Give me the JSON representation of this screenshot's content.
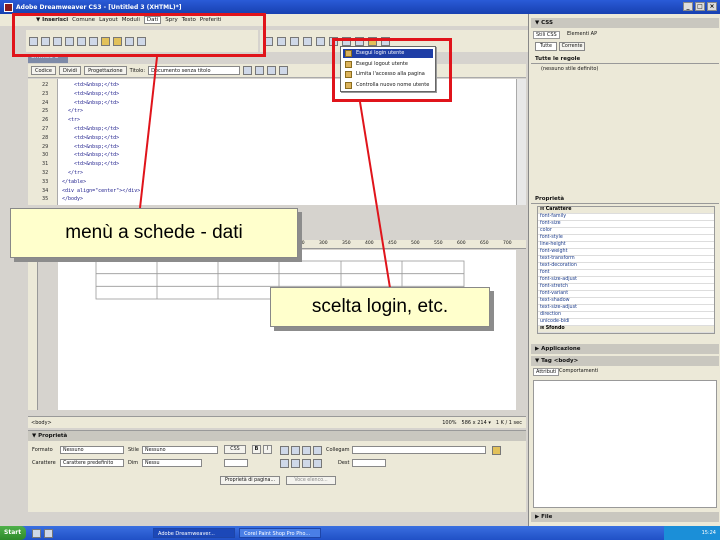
{
  "window": {
    "title": "Adobe Dreamweaver CS3 - [Untitled 3 (XHTML)*]",
    "controls": [
      "_",
      "□",
      "×"
    ]
  },
  "menubar": {
    "items": [
      "▼ Inserisci",
      "Comune",
      "Layout",
      "Moduli",
      "Dati",
      "Spry",
      "Testo",
      "Preferiti"
    ]
  },
  "document": {
    "tab": "Untitled-3",
    "views": {
      "code": "Codice",
      "split": "Dividi",
      "design": "Progettazione"
    },
    "title_label": "Titolo:",
    "title_value": "Documento senza titolo",
    "lines": [
      {
        "n": "22",
        "code": "    <td>&nbsp;</td>"
      },
      {
        "n": "23",
        "code": "    <td>&nbsp;</td>"
      },
      {
        "n": "24",
        "code": "    <td>&nbsp;</td>"
      },
      {
        "n": "25",
        "code": "  </tr>"
      },
      {
        "n": "26",
        "code": "  <tr>"
      },
      {
        "n": "27",
        "code": "    <td>&nbsp;</td>"
      },
      {
        "n": "28",
        "code": "    <td>&nbsp;</td>"
      },
      {
        "n": "29",
        "code": "    <td>&nbsp;</td>"
      },
      {
        "n": "30",
        "code": "    <td>&nbsp;</td>"
      },
      {
        "n": "31",
        "code": "    <td>&nbsp;</td>"
      },
      {
        "n": "32",
        "code": "  </tr>"
      },
      {
        "n": "33",
        "code": "</table>"
      },
      {
        "n": "34",
        "code": "<div align=\"center\"></div>"
      },
      {
        "n": "35",
        "code": "</body>"
      }
    ],
    "ruler_marks": [
      "250",
      "300",
      "350",
      "400",
      "450",
      "500",
      "550",
      "600",
      "650",
      "700"
    ]
  },
  "status": {
    "tag": "<body>",
    "zoom": "100%",
    "size": "586 x 214 ▾",
    "weight": "1 K / 1 sec"
  },
  "properties": {
    "title": "▼ Proprietà",
    "format_label": "Formato",
    "format_value": "Nessuno",
    "style_label": "Stile",
    "style_value": "Nessuno",
    "css_button": "CSS",
    "links_label": "Collegam",
    "font_label": "Carattere",
    "font_value": "Carattere predefinito",
    "size_label": "Dim",
    "size_value": "Nessu",
    "target_label": "Dest",
    "page_props_button": "Proprietà di pagina...",
    "list_item_button": "Voce elenco..."
  },
  "css_panel": {
    "title": "▼ CSS",
    "tab_css": "Stili CSS",
    "tab_ap": "Elementi AP",
    "btn_all": "Tutte",
    "btn_current": "Corrente",
    "rules_label": "Tutte le regole",
    "no_style": "(nessuno stile definito)",
    "props_label": "Proprietà",
    "group_font": "⊟ Carattere",
    "font_props": [
      "font-family",
      "font-size",
      "color",
      "font-style",
      "line-height",
      "font-weight",
      "text-transform",
      "text-decoration",
      "font",
      "font-size-adjust",
      "font-stretch",
      "font-variant",
      "text-shadow",
      "text-size-adjust",
      "direction",
      "unicode-bidi"
    ],
    "group_bg": "⊞ Sfondo"
  },
  "app_panel": {
    "title": "▶ Applicazione"
  },
  "tag_panel": {
    "title": "▼ Tag <body>",
    "tab_attr": "Attributi",
    "tab_behav": "Comportamenti"
  },
  "files_panel": {
    "title": "▶ File"
  },
  "login_menu": {
    "items": [
      {
        "label": "Esegui login utente",
        "selected": true
      },
      {
        "label": "Esegui logout utente",
        "selected": false
      },
      {
        "label": "Limita l'accesso alla pagina",
        "selected": false
      },
      {
        "label": "Controlla nuovo nome utente",
        "selected": false
      }
    ]
  },
  "callouts": {
    "tabs": "menù a schede - dati",
    "login": "scelta login, etc."
  },
  "taskbar": {
    "start": "Start",
    "tasks": [
      "Adobe Dreamweaver...",
      "Corel Paint Shop Pro Pho..."
    ],
    "clock": "15:24"
  },
  "colors": {
    "annotation_red": "#e0141b",
    "callout_fill": "#ffffcc"
  }
}
